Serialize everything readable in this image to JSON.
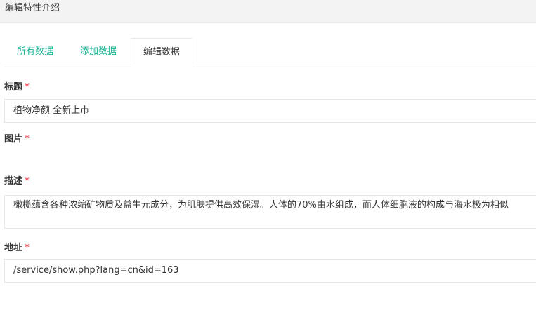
{
  "header": {
    "title": "编辑特性介绍"
  },
  "tabs": [
    {
      "label": "所有数据",
      "active": false
    },
    {
      "label": "添加数据",
      "active": false
    },
    {
      "label": "编辑数据",
      "active": true
    }
  ],
  "form": {
    "required_mark": "*",
    "title_label": "标题",
    "title_value": "植物净颜 全新上市",
    "image_label": "图片",
    "desc_label": "描述",
    "desc_value": "橄榄蕴含各种浓缩矿物质及益生元成分，为肌肤提供高效保湿。人体的70%由水组成，而人体细胞液的构成与海水极为相似",
    "url_label": "地址",
    "url_value": "/service/show.php?lang=cn&id=163"
  },
  "colors": {
    "accent": "#1ab394",
    "required": "#ed5565",
    "header_bg": "#f3f3f4",
    "border": "#e5e6e7"
  }
}
